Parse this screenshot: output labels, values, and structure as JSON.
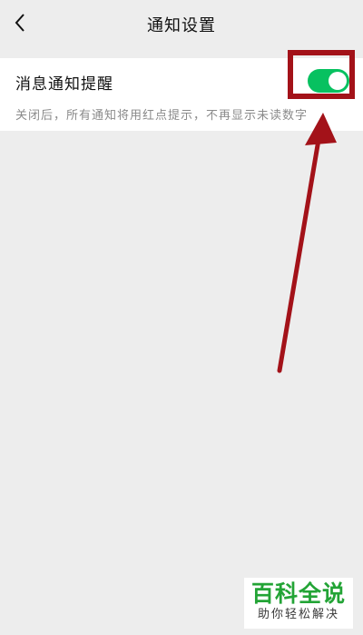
{
  "header": {
    "back_icon": "chevron-left-icon",
    "title": "通知设置"
  },
  "setting": {
    "label": "消息通知提醒",
    "description": "关闭后，所有通知将用红点提示，不再显示未读数字",
    "toggle_on": true
  },
  "annotation": {
    "color": "#a31219"
  },
  "watermark": {
    "main": "百科全说",
    "sub": "助你轻松解决"
  },
  "colors": {
    "toggle_on": "#07c160",
    "background": "#ededed",
    "watermark_green": "#23a436"
  }
}
